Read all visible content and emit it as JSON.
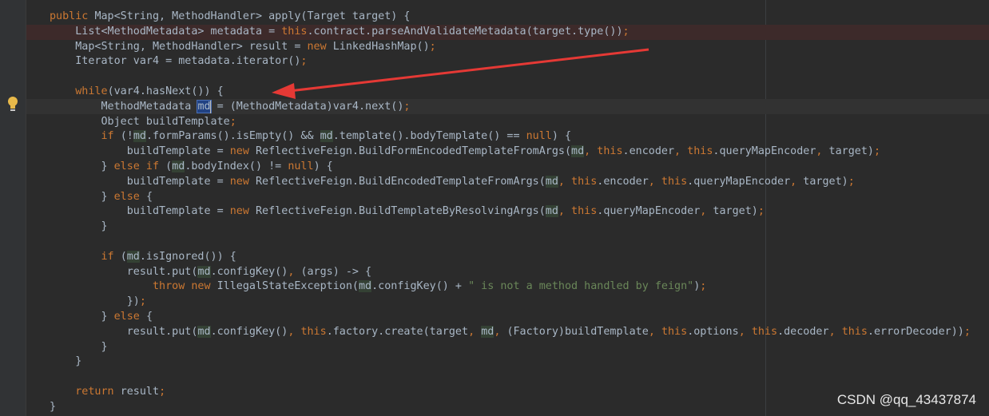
{
  "editor": {
    "lines": [
      [
        {
          "t": "public ",
          "k": "kw"
        },
        {
          "t": "Map<String, MethodHandler> apply(Target target) {"
        }
      ],
      [
        {
          "t": "    List<MethodMetadata> metadata = "
        },
        {
          "t": "this",
          "k": "kw"
        },
        {
          "t": ".contract.parseAndValidateMetadata(target.type())"
        },
        {
          "t": ";",
          "k": "kw"
        }
      ],
      [
        {
          "t": "    Map<String, MethodHandler> result = "
        },
        {
          "t": "new ",
          "k": "kw"
        },
        {
          "t": "LinkedHashMap()"
        },
        {
          "t": ";",
          "k": "kw"
        }
      ],
      [
        {
          "t": "    Iterator var4 = metadata.iterator()"
        },
        {
          "t": ";",
          "k": "kw"
        }
      ],
      [
        {
          "t": ""
        }
      ],
      [
        {
          "t": "    "
        },
        {
          "t": "while",
          "k": "kw"
        },
        {
          "t": "(var4.hasNext()) {"
        }
      ],
      [
        {
          "t": "        MethodMetadata "
        },
        {
          "t": "md",
          "k": "md-sel"
        },
        {
          "t": " = (MethodMetadata)var4.next()"
        },
        {
          "t": ";",
          "k": "kw"
        }
      ],
      [
        {
          "t": "        Object buildTemplate"
        },
        {
          "t": ";",
          "k": "kw"
        }
      ],
      [
        {
          "t": "        "
        },
        {
          "t": "if ",
          "k": "kw"
        },
        {
          "t": "(!"
        },
        {
          "t": "md",
          "k": "md"
        },
        {
          "t": ".formParams().isEmpty() && "
        },
        {
          "t": "md",
          "k": "md"
        },
        {
          "t": ".template().bodyTemplate() == "
        },
        {
          "t": "null",
          "k": "kw"
        },
        {
          "t": ") {"
        }
      ],
      [
        {
          "t": "            buildTemplate = "
        },
        {
          "t": "new ",
          "k": "kw"
        },
        {
          "t": "ReflectiveFeign.BuildFormEncodedTemplateFromArgs("
        },
        {
          "t": "md",
          "k": "md"
        },
        {
          "t": ", ",
          "k": "kw"
        },
        {
          "t": "this",
          "k": "kw"
        },
        {
          "t": ".encoder"
        },
        {
          "t": ", ",
          "k": "kw"
        },
        {
          "t": "this",
          "k": "kw"
        },
        {
          "t": ".queryMapEncoder"
        },
        {
          "t": ", ",
          "k": "kw"
        },
        {
          "t": "target)"
        },
        {
          "t": ";",
          "k": "kw"
        }
      ],
      [
        {
          "t": "        } "
        },
        {
          "t": "else if ",
          "k": "kw"
        },
        {
          "t": "("
        },
        {
          "t": "md",
          "k": "md"
        },
        {
          "t": ".bodyIndex() != "
        },
        {
          "t": "null",
          "k": "kw"
        },
        {
          "t": ") {"
        }
      ],
      [
        {
          "t": "            buildTemplate = "
        },
        {
          "t": "new ",
          "k": "kw"
        },
        {
          "t": "ReflectiveFeign.BuildEncodedTemplateFromArgs("
        },
        {
          "t": "md",
          "k": "md"
        },
        {
          "t": ", ",
          "k": "kw"
        },
        {
          "t": "this",
          "k": "kw"
        },
        {
          "t": ".encoder"
        },
        {
          "t": ", ",
          "k": "kw"
        },
        {
          "t": "this",
          "k": "kw"
        },
        {
          "t": ".queryMapEncoder"
        },
        {
          "t": ", ",
          "k": "kw"
        },
        {
          "t": "target)"
        },
        {
          "t": ";",
          "k": "kw"
        }
      ],
      [
        {
          "t": "        } "
        },
        {
          "t": "else ",
          "k": "kw"
        },
        {
          "t": "{"
        }
      ],
      [
        {
          "t": "            buildTemplate = "
        },
        {
          "t": "new ",
          "k": "kw"
        },
        {
          "t": "ReflectiveFeign.BuildTemplateByResolvingArgs("
        },
        {
          "t": "md",
          "k": "md"
        },
        {
          "t": ", ",
          "k": "kw"
        },
        {
          "t": "this",
          "k": "kw"
        },
        {
          "t": ".queryMapEncoder"
        },
        {
          "t": ", ",
          "k": "kw"
        },
        {
          "t": "target)"
        },
        {
          "t": ";",
          "k": "kw"
        }
      ],
      [
        {
          "t": "        }"
        }
      ],
      [
        {
          "t": ""
        }
      ],
      [
        {
          "t": "        "
        },
        {
          "t": "if ",
          "k": "kw"
        },
        {
          "t": "("
        },
        {
          "t": "md",
          "k": "md"
        },
        {
          "t": ".isIgnored()) {"
        }
      ],
      [
        {
          "t": "            result.put("
        },
        {
          "t": "md",
          "k": "md"
        },
        {
          "t": ".configKey()"
        },
        {
          "t": ", ",
          "k": "kw"
        },
        {
          "t": "(args) -> {"
        }
      ],
      [
        {
          "t": "                "
        },
        {
          "t": "throw new ",
          "k": "kw"
        },
        {
          "t": "IllegalStateException("
        },
        {
          "t": "md",
          "k": "md"
        },
        {
          "t": ".configKey() + "
        },
        {
          "t": "\" is not a method handled by feign\"",
          "k": "str"
        },
        {
          "t": ")"
        },
        {
          "t": ";",
          "k": "kw"
        }
      ],
      [
        {
          "t": "            })"
        },
        {
          "t": ";",
          "k": "kw"
        }
      ],
      [
        {
          "t": "        } "
        },
        {
          "t": "else ",
          "k": "kw"
        },
        {
          "t": "{"
        }
      ],
      [
        {
          "t": "            result.put("
        },
        {
          "t": "md",
          "k": "md"
        },
        {
          "t": ".configKey()"
        },
        {
          "t": ", ",
          "k": "kw"
        },
        {
          "t": "this",
          "k": "kw"
        },
        {
          "t": ".factory.create(target"
        },
        {
          "t": ", ",
          "k": "kw"
        },
        {
          "t": "md",
          "k": "md"
        },
        {
          "t": ", ",
          "k": "kw"
        },
        {
          "t": "(Factory)buildTemplate"
        },
        {
          "t": ", ",
          "k": "kw"
        },
        {
          "t": "this",
          "k": "kw"
        },
        {
          "t": ".options"
        },
        {
          "t": ", ",
          "k": "kw"
        },
        {
          "t": "this",
          "k": "kw"
        },
        {
          "t": ".decoder"
        },
        {
          "t": ", ",
          "k": "kw"
        },
        {
          "t": "this",
          "k": "kw"
        },
        {
          "t": ".errorDecoder))"
        },
        {
          "t": ";",
          "k": "kw"
        }
      ],
      [
        {
          "t": "        }"
        }
      ],
      [
        {
          "t": "    }"
        }
      ],
      [
        {
          "t": ""
        }
      ],
      [
        {
          "t": "    "
        },
        {
          "t": "return ",
          "k": "kw"
        },
        {
          "t": "result"
        },
        {
          "t": ";",
          "k": "kw"
        }
      ],
      [
        {
          "t": "}"
        }
      ]
    ]
  },
  "watermark": "CSDN @qq_43437874",
  "colors": {
    "background": "#2b2b2b",
    "keyword": "#cc7832",
    "text": "#a9b7c6",
    "string": "#6a8759",
    "arrow": "#e53935",
    "bulb": "#e8b94a"
  }
}
